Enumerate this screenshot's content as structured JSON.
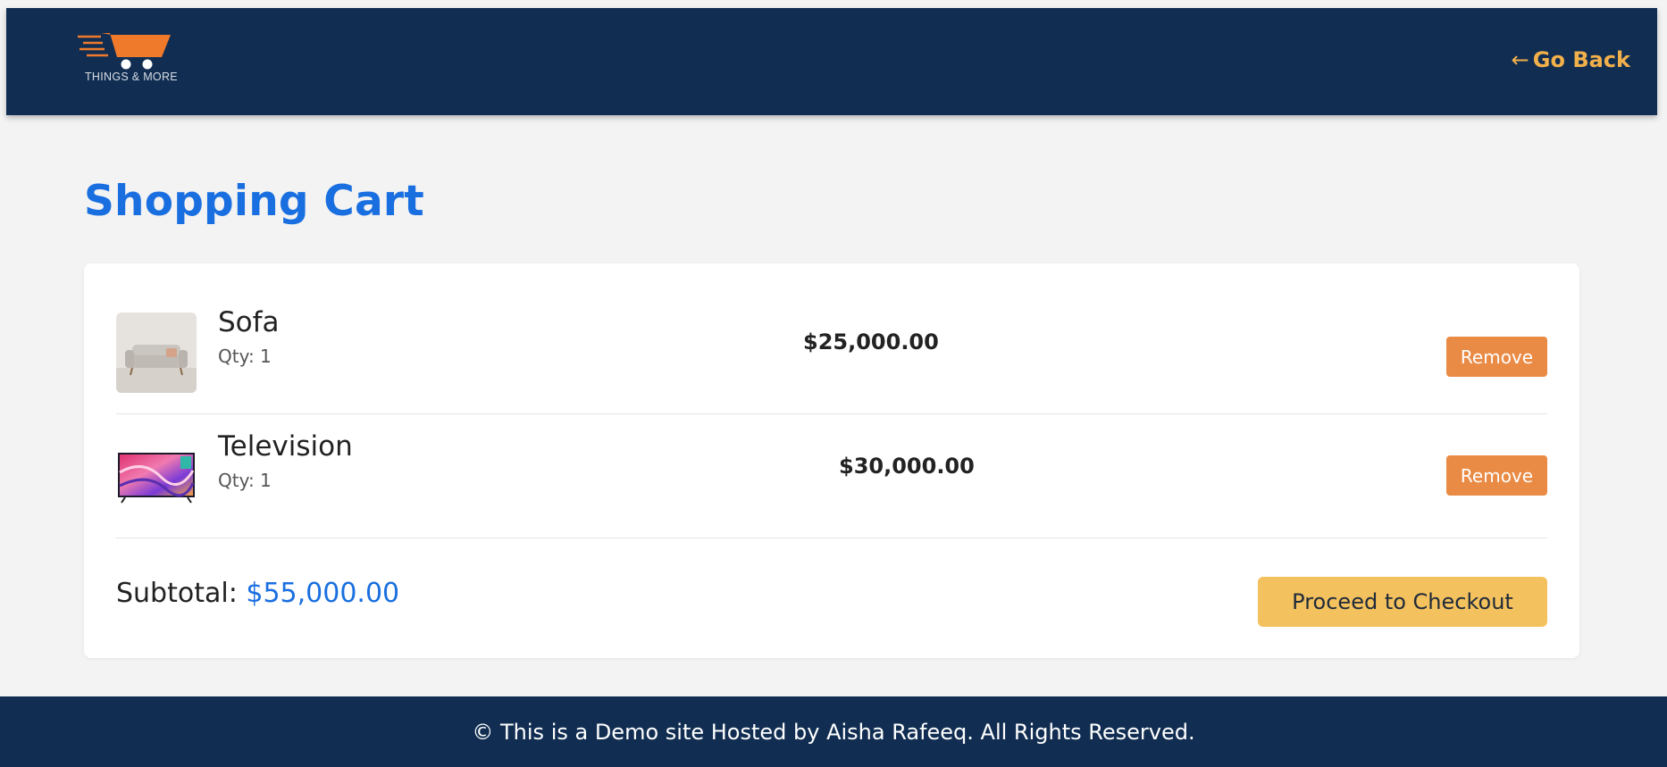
{
  "header": {
    "logo_text": "THINGS & MORE",
    "go_back_arrow": "←",
    "go_back_label": "Go Back"
  },
  "page": {
    "title": "Shopping Cart"
  },
  "cart": {
    "items": [
      {
        "name": "Sofa",
        "qty": "Qty: 1",
        "price": "$25,000.00",
        "remove_label": "Remove",
        "image_icon": "sofa-thumbnail"
      },
      {
        "name": "Television",
        "qty": "Qty: 1",
        "price": "$30,000.00",
        "remove_label": "Remove",
        "image_icon": "television-thumbnail"
      }
    ],
    "subtotal_label": "Subtotal:",
    "subtotal_value": "$55,000.00",
    "checkout_label": "Proceed to Checkout"
  },
  "footer": {
    "text": "© This is a Demo site Hosted by Aisha Rafeeq. All Rights Reserved."
  },
  "colors": {
    "header_bg": "#112e52",
    "accent_blue": "#1a6fe0",
    "remove_orange": "#e98b45",
    "checkout_yellow": "#f3c15d",
    "go_back_gold": "#f2b04a"
  }
}
